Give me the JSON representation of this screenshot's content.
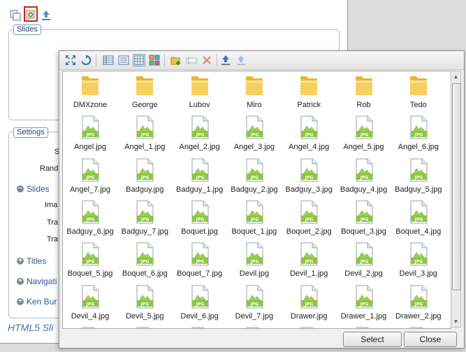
{
  "background_panel": {
    "toolbar_icons": [
      "copy-slides-icon",
      "browse-images-icon",
      "upload-icon"
    ],
    "slides_legend": "Slides",
    "settings_legend": "Settings",
    "settings_rows": [
      "S",
      "Rand"
    ],
    "slides_section": {
      "label": "Slides",
      "state": "expanded",
      "rows": [
        "Ima",
        "Tra",
        "Tra"
      ]
    },
    "collapsed_sections": [
      {
        "label": "Titles"
      },
      {
        "label": "Navigati"
      },
      {
        "label": "Ken Bur"
      }
    ],
    "footer_title": "HTML5 Sli"
  },
  "file_browser": {
    "toolbar_icons": [
      "expand-icon",
      "refresh-icon",
      "details-view-icon",
      "list-view-icon",
      "small-icons-view-icon",
      "thumbnails-view-icon",
      "new-folder-icon",
      "rename-icon",
      "delete-icon",
      "upload-icon",
      "download-icon"
    ],
    "files": [
      {
        "name": "DMXzone",
        "type": "folder"
      },
      {
        "name": "George",
        "type": "folder"
      },
      {
        "name": "Lubov",
        "type": "folder"
      },
      {
        "name": "Miro",
        "type": "folder"
      },
      {
        "name": "Patrick",
        "type": "folder"
      },
      {
        "name": "Rob",
        "type": "folder"
      },
      {
        "name": "Tedo",
        "type": "folder"
      },
      {
        "name": "Angel.jpg",
        "type": "jpg"
      },
      {
        "name": "Angel_1.jpg",
        "type": "jpg"
      },
      {
        "name": "Angel_2.jpg",
        "type": "jpg"
      },
      {
        "name": "Angel_3.jpg",
        "type": "jpg"
      },
      {
        "name": "Angel_4.jpg",
        "type": "jpg"
      },
      {
        "name": "Angel_5.jpg",
        "type": "jpg"
      },
      {
        "name": "Angel_6.jpg",
        "type": "jpg"
      },
      {
        "name": "Angel_7.jpg",
        "type": "jpg"
      },
      {
        "name": "Badguy.jpg",
        "type": "jpg"
      },
      {
        "name": "Badguy_1.jpg",
        "type": "jpg"
      },
      {
        "name": "Badguy_2.jpg",
        "type": "jpg"
      },
      {
        "name": "Badguy_3.jpg",
        "type": "jpg"
      },
      {
        "name": "Badguy_4.jpg",
        "type": "jpg"
      },
      {
        "name": "Badguy_5.jpg",
        "type": "jpg"
      },
      {
        "name": "Badguy_6.jpg",
        "type": "jpg"
      },
      {
        "name": "Badguy_7.jpg",
        "type": "jpg"
      },
      {
        "name": "Boquet.jpg",
        "type": "jpg"
      },
      {
        "name": "Boquet_1.jpg",
        "type": "jpg"
      },
      {
        "name": "Boquet_2.jpg",
        "type": "jpg"
      },
      {
        "name": "Boquet_3.jpg",
        "type": "jpg"
      },
      {
        "name": "Boquet_4.jpg",
        "type": "jpg"
      },
      {
        "name": "Boquet_5.jpg",
        "type": "jpg"
      },
      {
        "name": "Boquet_6.jpg",
        "type": "jpg"
      },
      {
        "name": "Boquet_7.jpg",
        "type": "jpg"
      },
      {
        "name": "Devil.jpg",
        "type": "jpg"
      },
      {
        "name": "Devil_1.jpg",
        "type": "jpg"
      },
      {
        "name": "Devil_2.jpg",
        "type": "jpg"
      },
      {
        "name": "Devil_3.jpg",
        "type": "jpg"
      },
      {
        "name": "Devil_4.jpg",
        "type": "jpg"
      },
      {
        "name": "Devil_5.jpg",
        "type": "jpg"
      },
      {
        "name": "Devil_6.jpg",
        "type": "jpg"
      },
      {
        "name": "Devil_7.jpg",
        "type": "jpg"
      },
      {
        "name": "Drawer.jpg",
        "type": "jpg"
      },
      {
        "name": "Drawer_1.jpg",
        "type": "jpg"
      },
      {
        "name": "Drawer_2.jpg",
        "type": "jpg"
      }
    ],
    "select_button": "Select",
    "close_button": "Close",
    "colors": {
      "accent_selected": "#c0242a",
      "jpg_green": "#8dc63f",
      "folder": "#f3c94a"
    }
  }
}
